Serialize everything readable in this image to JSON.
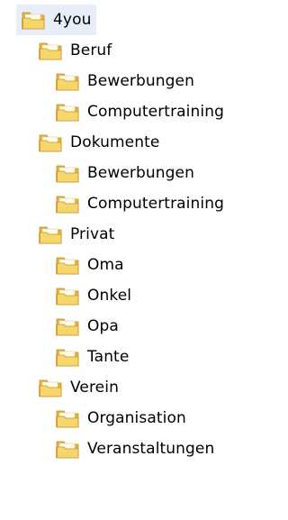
{
  "colors": {
    "folder_back": "#e3b33e",
    "folder_front": "#f6d76b",
    "folder_shade": "#c9922a",
    "folder_paper": "#fffbe8",
    "selection_bg": "#e7eef9"
  },
  "tree": {
    "label": "4you",
    "icon": "folder-icon",
    "selected": true,
    "children": [
      {
        "label": "Beruf",
        "icon": "folder-icon",
        "children": [
          {
            "label": "Bewerbungen",
            "icon": "folder-icon"
          },
          {
            "label": "Computertraining",
            "icon": "folder-icon"
          }
        ]
      },
      {
        "label": "Dokumente",
        "icon": "folder-icon",
        "children": [
          {
            "label": "Bewerbungen",
            "icon": "folder-icon"
          },
          {
            "label": "Computertraining",
            "icon": "folder-icon"
          }
        ]
      },
      {
        "label": "Privat",
        "icon": "folder-icon",
        "children": [
          {
            "label": "Oma",
            "icon": "folder-icon"
          },
          {
            "label": "Onkel",
            "icon": "folder-icon"
          },
          {
            "label": "Opa",
            "icon": "folder-icon"
          },
          {
            "label": "Tante",
            "icon": "folder-icon"
          }
        ]
      },
      {
        "label": "Verein",
        "icon": "folder-icon",
        "children": [
          {
            "label": "Organisation",
            "icon": "folder-icon"
          },
          {
            "label": "Veranstaltungen",
            "icon": "folder-icon"
          }
        ]
      }
    ]
  }
}
